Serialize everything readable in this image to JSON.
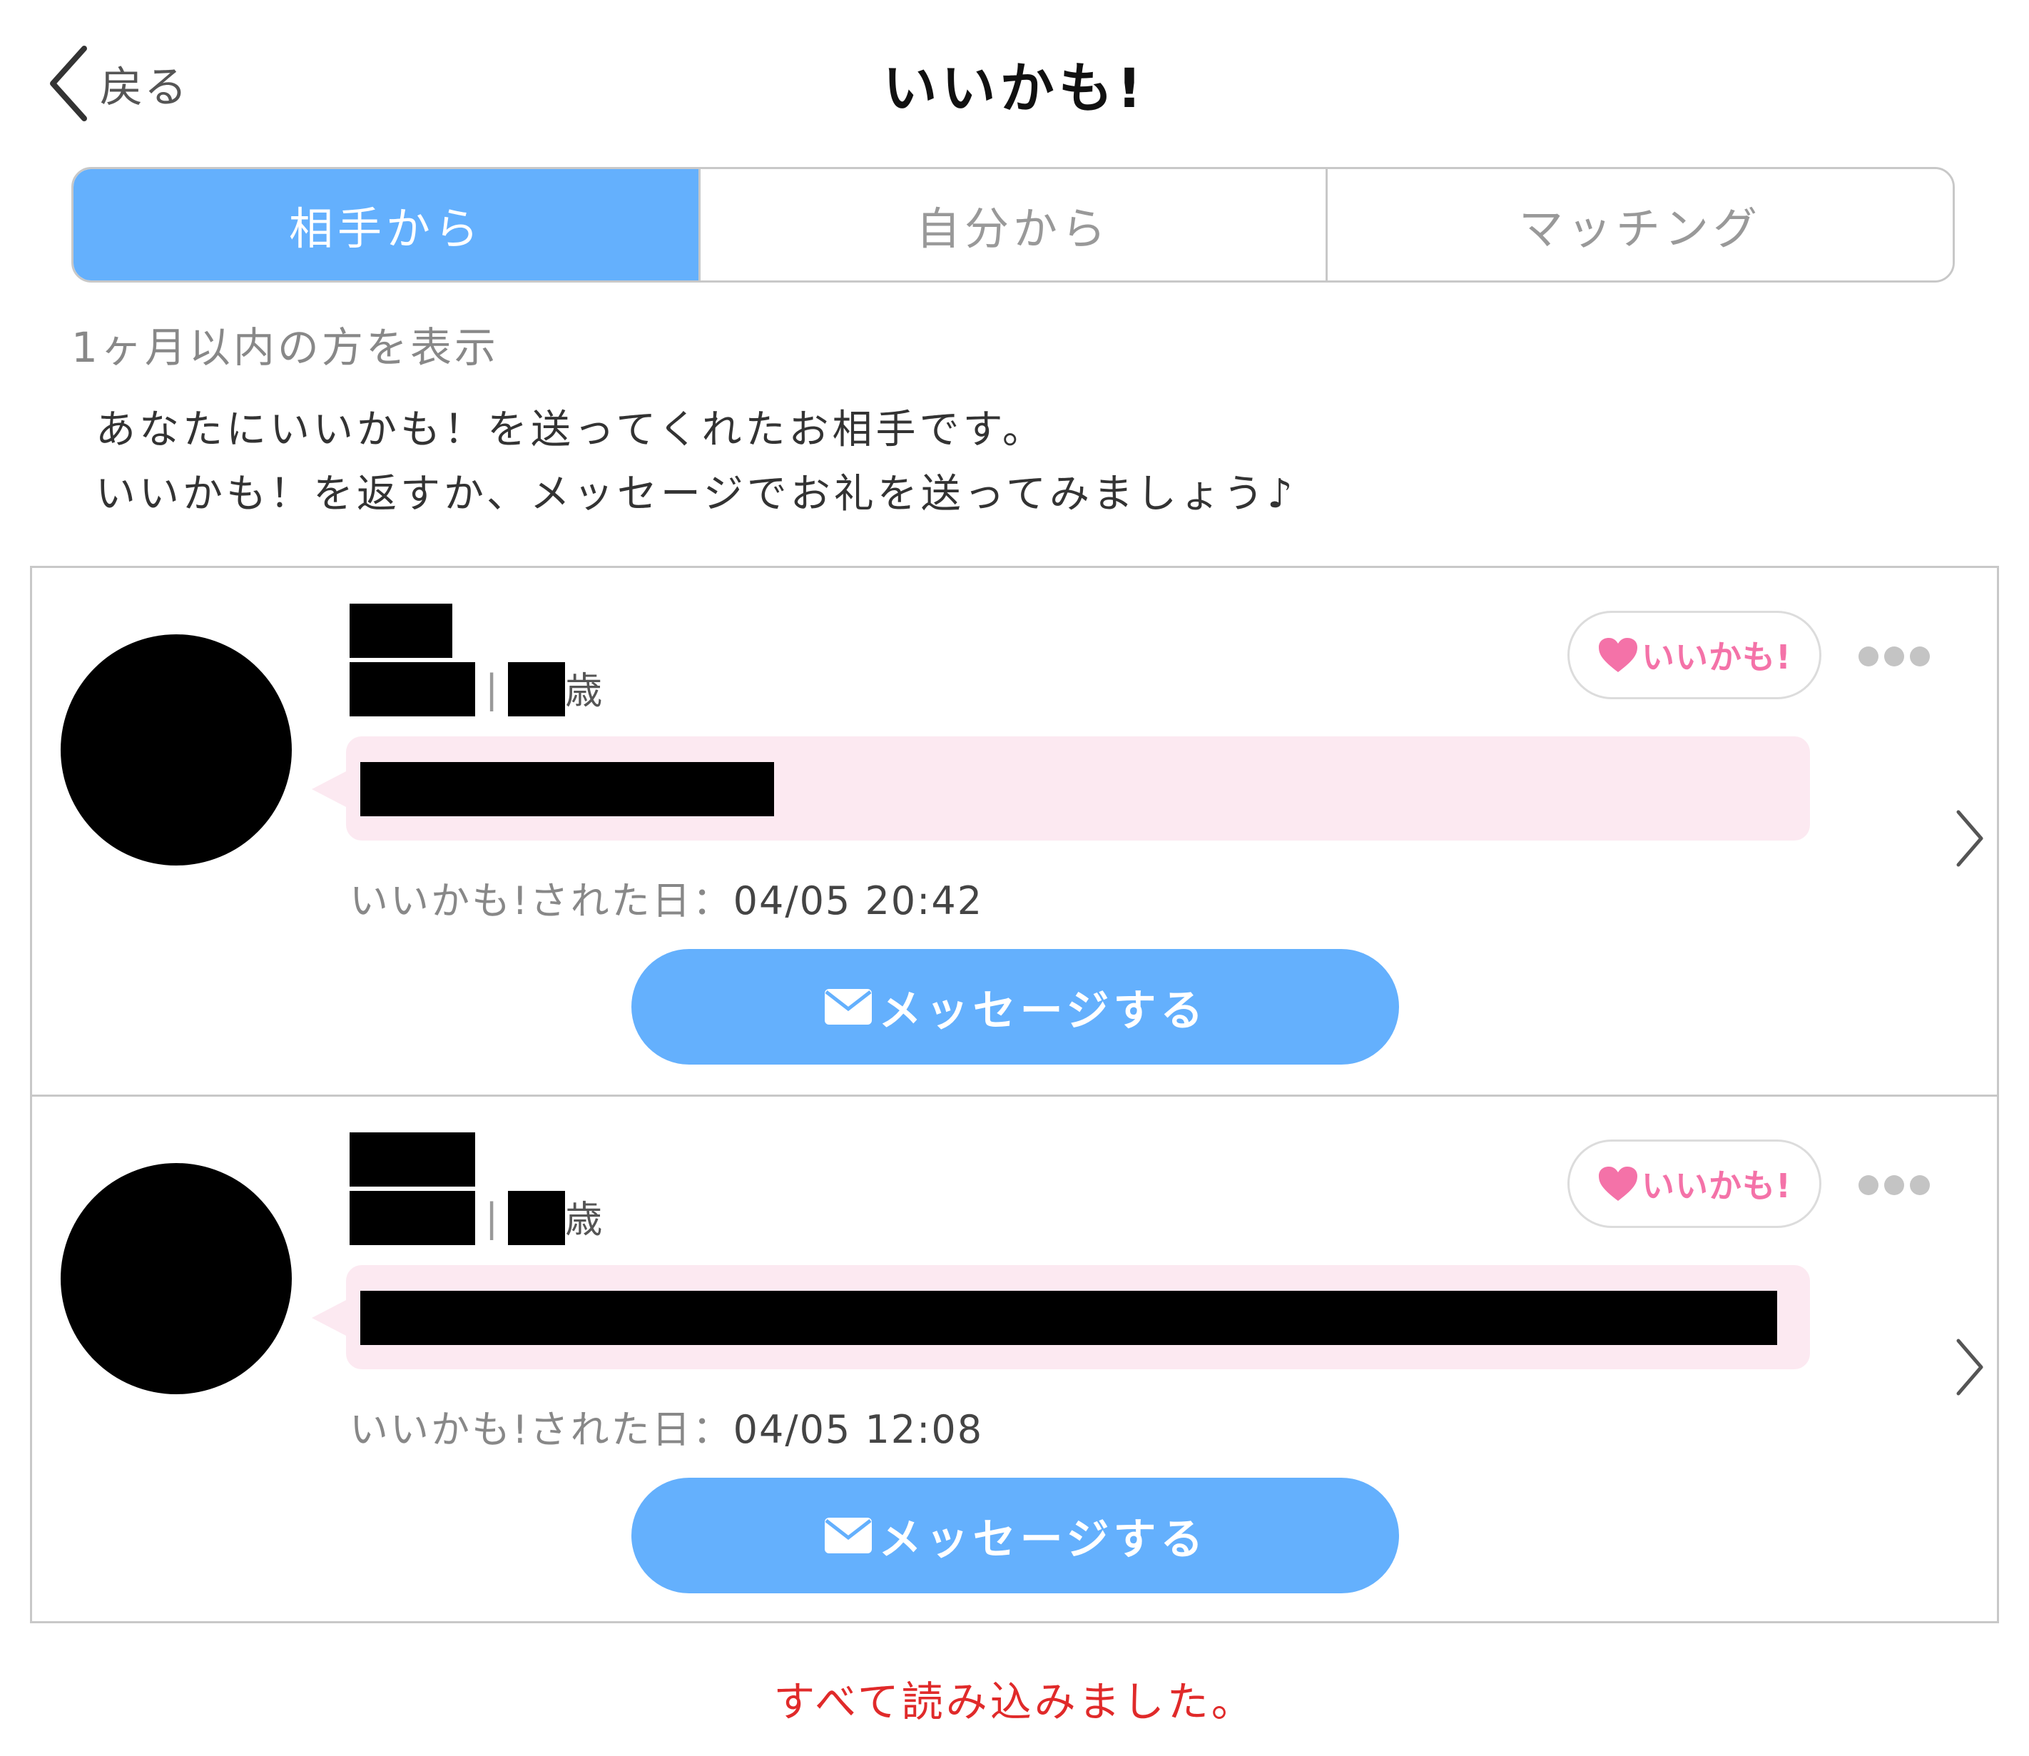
{
  "header": {
    "back_label": "戻る",
    "title": "いいかも!"
  },
  "tabs": [
    {
      "label": "相手から",
      "active": true
    },
    {
      "label": "自分から",
      "active": false
    },
    {
      "label": "マッチング",
      "active": false
    }
  ],
  "filter_text": "1ヶ月以内の方を表示",
  "intro": {
    "line1": "あなたにいいかも！を送ってくれたお相手です。",
    "line2": "いいかも！を返すか、メッセージでお礼を送ってみましょう♪"
  },
  "cards": [
    {
      "age_unit": "歳",
      "like_badge_label": "いいかも!",
      "date_label": "いいかも!された日：",
      "date_value": "04/05 20:42",
      "message_button_label": "メッセージする"
    },
    {
      "age_unit": "歳",
      "like_badge_label": "いいかも!",
      "date_label": "いいかも!された日：",
      "date_value": "04/05 12:08",
      "message_button_label": "メッセージする"
    }
  ],
  "footer_status": "すべて読み込みました。",
  "colors": {
    "accent_blue": "#64b0fd",
    "bubble_pink": "#fce9f1",
    "heart_pink": "#f472a8",
    "status_red": "#e02a2a"
  },
  "icons": {
    "back": "chevron-left-icon",
    "heart": "heart-icon",
    "more": "more-dots-icon",
    "row_arrow": "chevron-right-icon",
    "mail": "mail-icon"
  }
}
